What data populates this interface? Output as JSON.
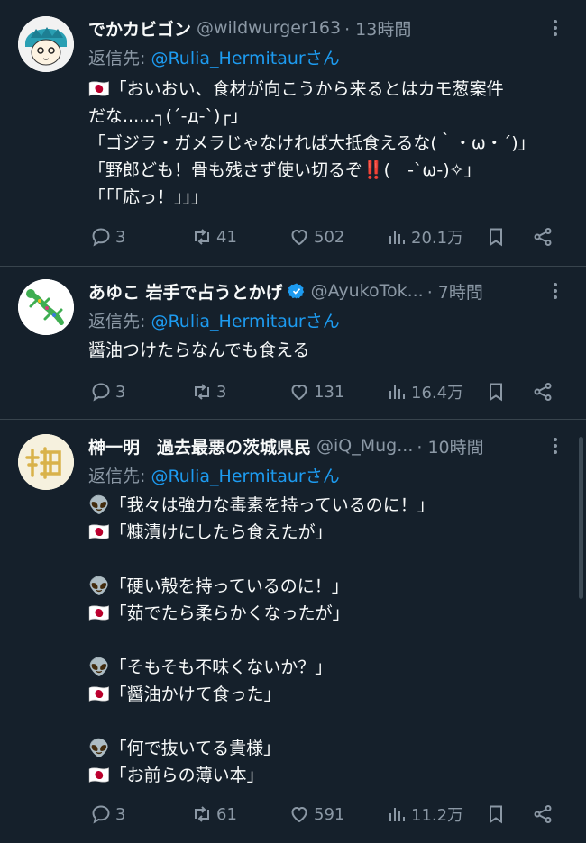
{
  "tweets": [
    {
      "name": "でかカビゴン",
      "handle": "@wildwurger163",
      "time": "· 13時間",
      "reply_prefix": "返信先:",
      "reply_mention": "@Rulia_Hermitaurさん",
      "body": "🇯🇵「おいおい、食材が向こうから来るとはカモ葱案件\nだな......┐(´-д-`)┌」\n「ゴジラ・ガメラじゃなければ大抵食えるな(｀・ω・´)」\n「野郎ども！骨も残さず使い切るぞ‼️(　-`ω-)✧」\n「｢｢応っ！」」」",
      "replies": "3",
      "retweets": "41",
      "likes": "502",
      "views": "20.1万"
    },
    {
      "name": "あゆこ 岩手で占うとかげ",
      "handle": "@AyukoTok...",
      "time": "· 7時間",
      "verified": true,
      "reply_prefix": "返信先:",
      "reply_mention": "@Rulia_Hermitaurさん",
      "body": "醤油つけたらなんでも食える",
      "replies": "3",
      "retweets": "3",
      "likes": "131",
      "views": "16.4万"
    },
    {
      "name": "榊一明　過去最悪の茨城県民",
      "handle": "@iQ_Mug...",
      "time": "· 10時間",
      "reply_prefix": "返信先:",
      "reply_mention": "@Rulia_Hermitaurさん",
      "body": "👽「我々は強力な毒素を持っているのに！」\n🇯🇵「糠漬けにしたら食えたが」\n\n👽「硬い殻を持っているのに！」\n🇯🇵「茹でたら柔らかくなったが」\n\n👽「そもそも不味くないか？」\n🇯🇵「醤油かけて食った」\n\n👽「何で抜いてる貴様」\n🇯🇵「お前らの薄い本」",
      "replies": "3",
      "retweets": "61",
      "likes": "591",
      "views": "11.2万"
    }
  ],
  "icons": {
    "reply": "reply-icon",
    "retweet": "retweet-icon",
    "like": "like-icon",
    "views": "views-icon",
    "bookmark": "bookmark-icon",
    "share": "share-icon",
    "more": "more-icon"
  },
  "colors": {
    "background": "#15202b",
    "text": "#f7f9f9",
    "muted": "#8b98a5",
    "accent": "#1d9bf0",
    "divider": "#38444d"
  }
}
